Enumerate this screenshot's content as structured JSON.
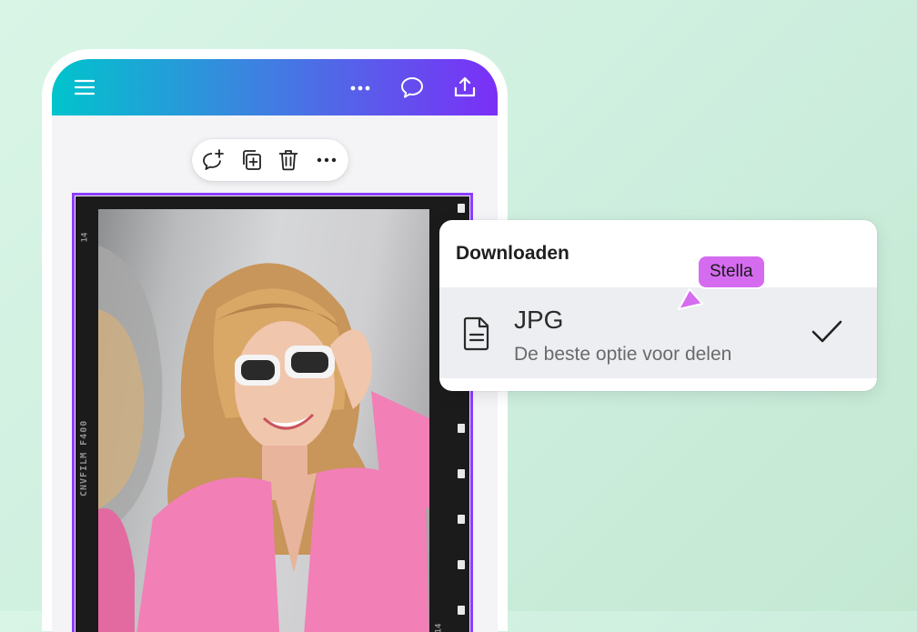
{
  "topbar": {
    "icons": [
      "menu-icon",
      "more-icon",
      "comment-icon",
      "share-icon"
    ],
    "gradient": [
      "#00c4cc",
      "#3c83e0",
      "#7b2ff7"
    ]
  },
  "floating_toolbar": {
    "icons": [
      "add-comment-icon",
      "duplicate-icon",
      "delete-icon",
      "more-icon"
    ]
  },
  "canvas": {
    "film_label": "CNVFILM F400",
    "film_numbers": [
      "14",
      "14"
    ],
    "selection_color": "#8b3dff"
  },
  "download_menu": {
    "title": "Downloaden",
    "item": {
      "title": "JPG",
      "subtitle": "De beste optie voor delen",
      "selected": true
    }
  },
  "collaborator": {
    "name": "Stella",
    "color": "#d56cf0"
  }
}
